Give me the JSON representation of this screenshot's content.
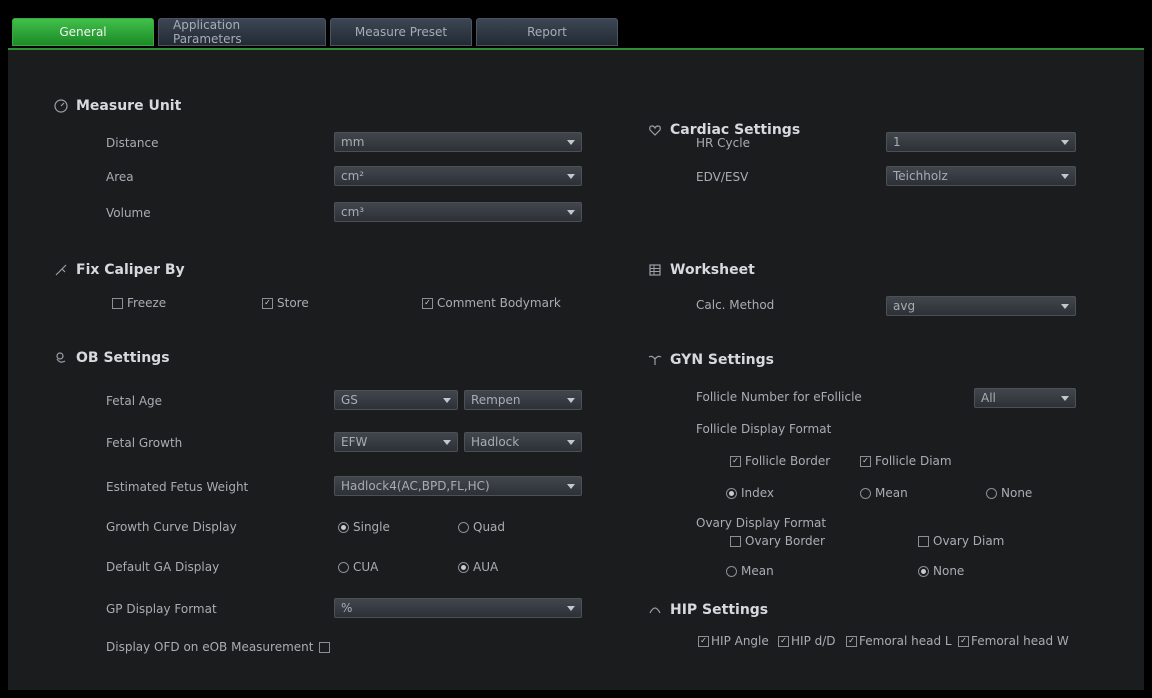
{
  "tabs": [
    {
      "label": "General",
      "active": true
    },
    {
      "label": "Application Parameters",
      "active": false
    },
    {
      "label": "Measure Preset",
      "active": false
    },
    {
      "label": "Report",
      "active": false
    }
  ],
  "measure_unit": {
    "title": "Measure Unit",
    "icon": "gauge-icon",
    "rows": [
      {
        "label": "Distance",
        "value": "mm"
      },
      {
        "label": "Area",
        "value": "cm²"
      },
      {
        "label": "Volume",
        "value": "cm³"
      }
    ]
  },
  "fix_caliper": {
    "title": "Fix Caliper By",
    "icon": "caliper-icon",
    "options": [
      {
        "label": "Freeze",
        "checked": false
      },
      {
        "label": "Store",
        "checked": true
      },
      {
        "label": "Comment Bodymark",
        "checked": true
      }
    ]
  },
  "ob_settings": {
    "title": "OB Settings",
    "icon": "fetus-icon",
    "fetal_age": {
      "label": "Fetal Age",
      "value1": "GS",
      "value2": "Rempen"
    },
    "fetal_growth": {
      "label": "Fetal Growth",
      "value1": "EFW",
      "value2": "Hadlock"
    },
    "estimated_fetus_weight": {
      "label": "Estimated Fetus Weight",
      "value": "Hadlock4(AC,BPD,FL,HC)"
    },
    "growth_curve_display": {
      "label": "Growth Curve Display",
      "options": [
        {
          "label": "Single",
          "selected": true
        },
        {
          "label": "Quad",
          "selected": false
        }
      ]
    },
    "default_ga_display": {
      "label": "Default GA Display",
      "options": [
        {
          "label": "CUA",
          "selected": false
        },
        {
          "label": "AUA",
          "selected": true
        }
      ]
    },
    "gp_display_format": {
      "label": "GP Display Format",
      "value": "%"
    },
    "display_ofd": {
      "label": "Display OFD on eOB Measurement",
      "checked": false
    }
  },
  "cardiac_settings": {
    "title": "Cardiac Settings",
    "icon": "heart-icon",
    "rows": [
      {
        "label": "HR Cycle",
        "value": "1"
      },
      {
        "label": "EDV/ESV",
        "value": "Teichholz"
      }
    ]
  },
  "worksheet": {
    "title": "Worksheet",
    "icon": "worksheet-icon",
    "calc_method": {
      "label": "Calc. Method",
      "value": "avg"
    }
  },
  "gyn_settings": {
    "title": "GYN Settings",
    "icon": "uterus-icon",
    "follicle_number": {
      "label": "Follicle Number for eFollicle",
      "value": "All"
    },
    "follicle_display_format": {
      "label": "Follicle Display Format",
      "checks": [
        {
          "label": "Follicle Border",
          "checked": true
        },
        {
          "label": "Follicle Diam",
          "checked": true
        }
      ],
      "radios": [
        {
          "label": "Index",
          "selected": true
        },
        {
          "label": "Mean",
          "selected": false
        },
        {
          "label": "None",
          "selected": false
        }
      ]
    },
    "ovary_display_format": {
      "label": "Ovary Display Format",
      "checks": [
        {
          "label": "Ovary Border",
          "checked": false
        },
        {
          "label": "Ovary Diam",
          "checked": false
        }
      ],
      "radios": [
        {
          "label": "Mean",
          "selected": false
        },
        {
          "label": "None",
          "selected": true
        }
      ]
    }
  },
  "hip_settings": {
    "title": "HIP Settings",
    "icon": "hip-icon",
    "options": [
      {
        "label": "HIP Angle",
        "checked": true
      },
      {
        "label": "HIP d/D",
        "checked": true
      },
      {
        "label": "Femoral head L",
        "checked": true
      },
      {
        "label": "Femoral head W",
        "checked": true
      }
    ]
  }
}
